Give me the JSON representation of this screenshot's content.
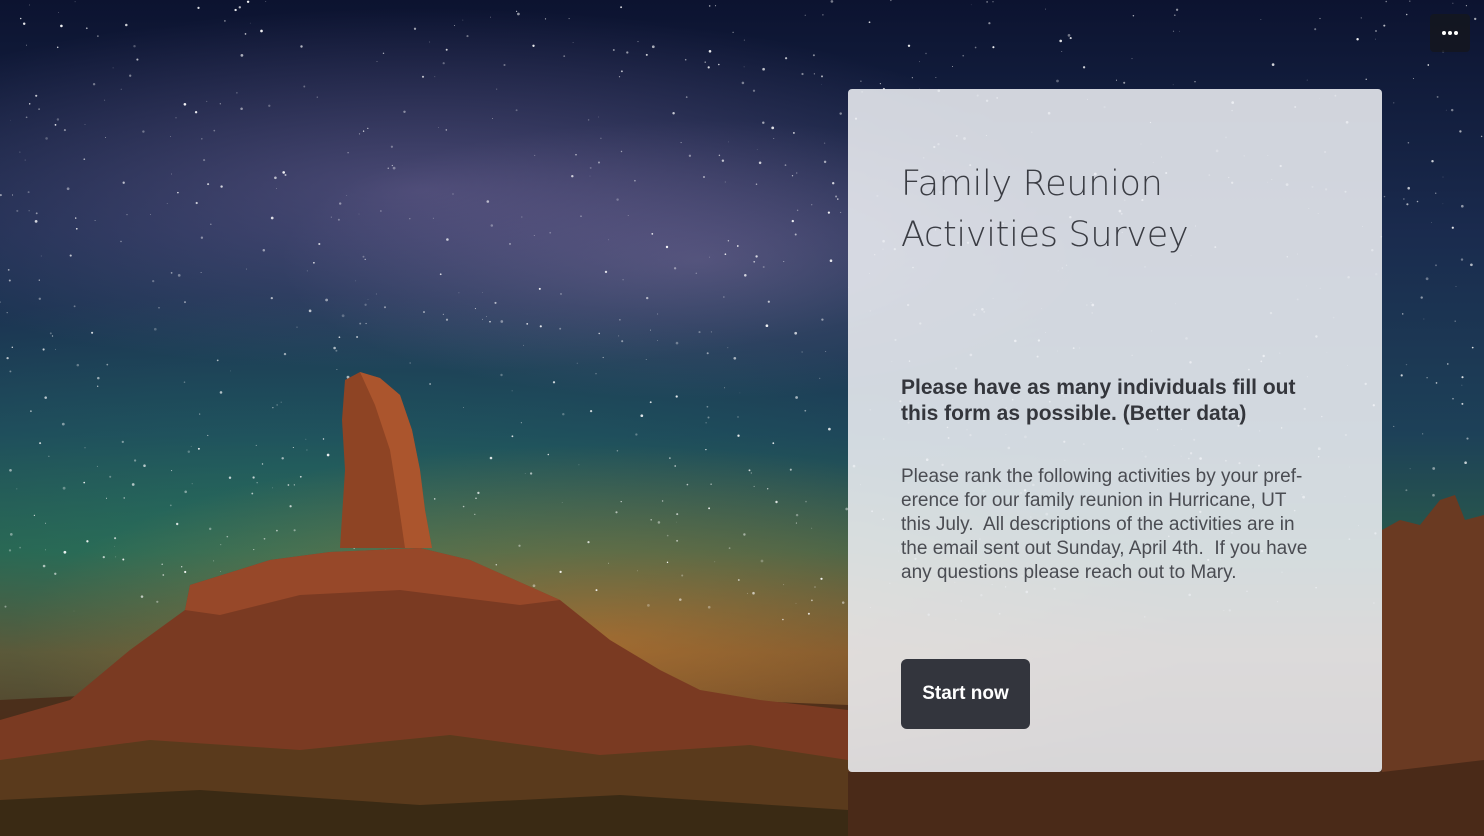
{
  "toolbar": {
    "more_icon": "more-horizontal-icon"
  },
  "welcome_card": {
    "title_line1": "Family Reunion",
    "title_line2": "Activities Survey",
    "subtitle": "Please have as many individuals fill out this form as possible. (Better data)",
    "description": "Please rank the following activities by your pref-\nerence for our family reunion in Hurricane, UT\nthis July.  All descriptions of the activities are in\nthe email sent out Sunday, April 4th.  If you have\nany questions please reach out to Mary.",
    "start_label": "Start now"
  },
  "colors": {
    "card_background": "#eceef3",
    "button_background": "#33353d",
    "button_text": "#ffffff",
    "title_text": "#3a3c43"
  }
}
